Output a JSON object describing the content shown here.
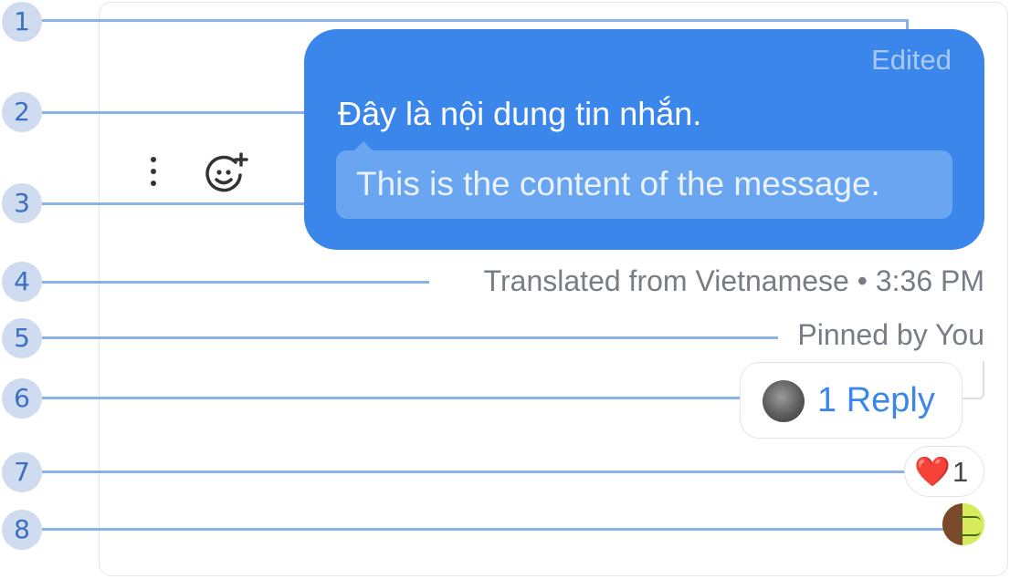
{
  "message": {
    "edited_label": "Edited",
    "original_text": "Đây là nội dung tin nhắn.",
    "translated_text": "This is the content of the message."
  },
  "meta": {
    "translation_note": "Translated from Vietnamese • 3:36 PM",
    "pinned_label": "Pinned by You"
  },
  "thread": {
    "reply_label": "1 Reply"
  },
  "reactions": {
    "emoji": "❤️",
    "count": "1"
  },
  "actions": {
    "more_icon": "more-vertical-icon",
    "react_icon": "add-reaction-icon"
  },
  "callouts": [
    "1",
    "2",
    "3",
    "4",
    "5",
    "6",
    "7",
    "8"
  ],
  "colors": {
    "bubble": "#3b86ea",
    "callout_bg": "#cfdcf0",
    "callout_line": "#8bb2e6",
    "accent_text": "#3b86ea"
  }
}
